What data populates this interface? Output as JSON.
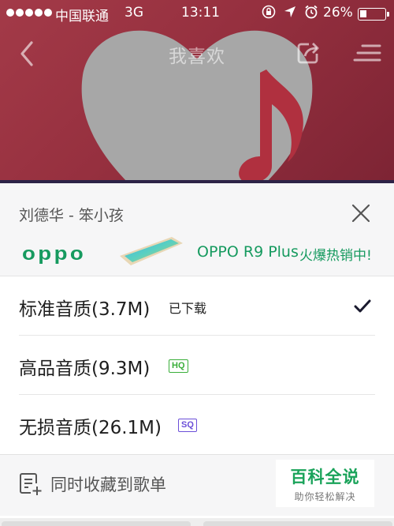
{
  "statusbar": {
    "carrier": "中国联通",
    "network": "3G",
    "time": "13:11",
    "battery_percent": "26%",
    "battery_level": 0.26,
    "icons": [
      "signal-dots-icon",
      "orientation-lock-icon",
      "location-arrow-icon",
      "alarm-clock-icon",
      "battery-icon"
    ]
  },
  "navbar": {
    "title": "我喜欢",
    "back_icon": "chevron-left-icon",
    "share_icon": "share-icon",
    "menu_icon": "menu-icon"
  },
  "sheet": {
    "song_title": "刘德华 - 笨小孩",
    "close_icon": "close-icon",
    "ad": {
      "brand": "oppo",
      "model": "OPPO R9 Plus",
      "slogan": "火爆热销中!"
    },
    "qualities": [
      {
        "label": "标准音质(3.7M)",
        "status": "已下载",
        "selected": true
      },
      {
        "label": "高品音质(9.3M)",
        "badge": "HQ"
      },
      {
        "label": "无损音质(26.1M)",
        "badge": "SQ"
      }
    ],
    "collect_label": "同时收藏到歌单",
    "watermark": {
      "title": "百科全说",
      "subtitle": "助你轻松解决"
    }
  },
  "colors": {
    "hero_red": "#96303f",
    "ad_green": "#169a5f",
    "hq_green": "#3aae3a",
    "sq_purple": "#6b4fd8"
  }
}
